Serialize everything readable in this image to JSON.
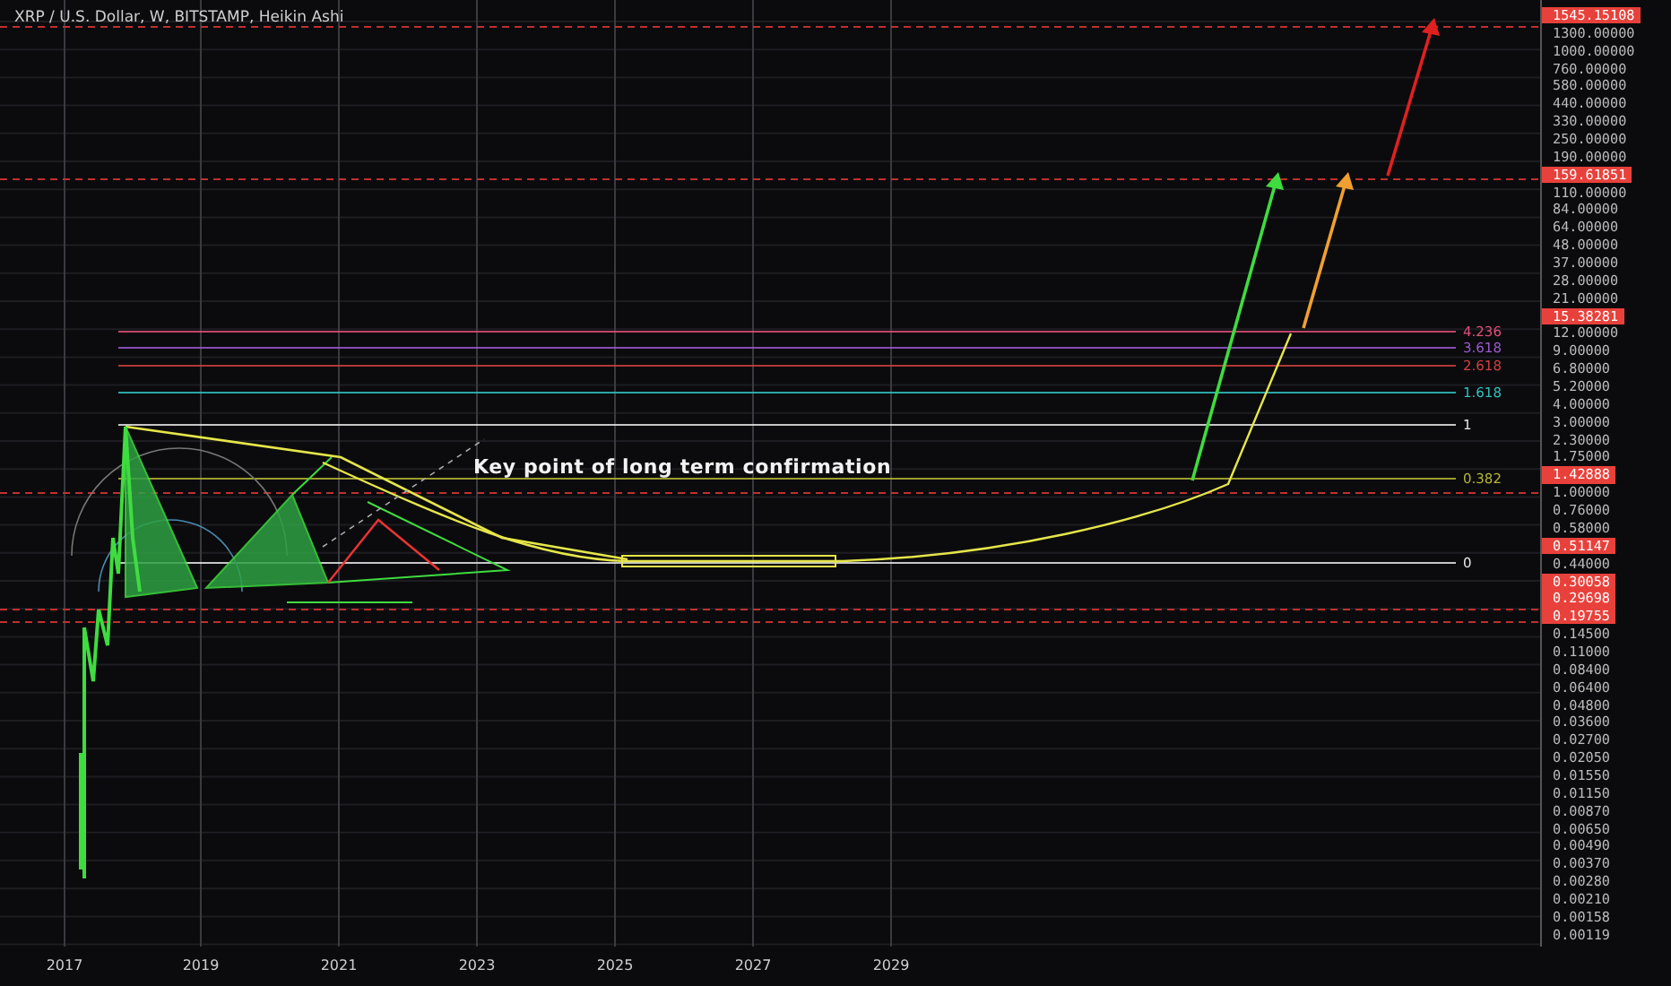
{
  "chart": {
    "title": "XRP / U.S. Dollar, W, BITSTAMP, Heikin Ashi",
    "annotation": "Key point of long term confirmation",
    "fib_levels": [
      {
        "label": "4.236",
        "color": "#e0507a"
      },
      {
        "label": "3.618",
        "color": "#9b59d0"
      },
      {
        "label": "2.618",
        "color": "#d04040"
      },
      {
        "label": "1.618",
        "color": "#30c0c0"
      },
      {
        "label": "1",
        "color": "#e8e8e8"
      },
      {
        "label": "0.382",
        "color": "#b5b536"
      },
      {
        "label": "0",
        "color": "#e8e8e8"
      }
    ]
  },
  "price_axis": [
    {
      "kind": "marker",
      "label": "1545.15108"
    },
    {
      "kind": "tick",
      "label": "1300.00000"
    },
    {
      "kind": "tick",
      "label": "1000.00000"
    },
    {
      "kind": "tick",
      "label": "760.00000"
    },
    {
      "kind": "tick",
      "label": "580.00000"
    },
    {
      "kind": "tick",
      "label": "440.00000"
    },
    {
      "kind": "tick",
      "label": "330.00000"
    },
    {
      "kind": "tick",
      "label": "250.00000"
    },
    {
      "kind": "tick",
      "label": "190.00000"
    },
    {
      "kind": "marker",
      "label": "159.61851"
    },
    {
      "kind": "tick",
      "label": "110.00000"
    },
    {
      "kind": "tick",
      "label": "84.00000"
    },
    {
      "kind": "tick",
      "label": "64.00000"
    },
    {
      "kind": "tick",
      "label": "48.00000"
    },
    {
      "kind": "tick",
      "label": "37.00000"
    },
    {
      "kind": "tick",
      "label": "28.00000"
    },
    {
      "kind": "tick",
      "label": "21.00000"
    },
    {
      "kind": "marker",
      "label": "15.38281"
    },
    {
      "kind": "tick",
      "label": "12.00000"
    },
    {
      "kind": "tick",
      "label": "9.00000"
    },
    {
      "kind": "tick",
      "label": "6.80000"
    },
    {
      "kind": "tick",
      "label": "5.20000"
    },
    {
      "kind": "tick",
      "label": "4.00000"
    },
    {
      "kind": "tick",
      "label": "3.00000"
    },
    {
      "kind": "tick",
      "label": "2.30000"
    },
    {
      "kind": "tick",
      "label": "1.75000"
    },
    {
      "kind": "marker",
      "label": "1.42888"
    },
    {
      "kind": "tick",
      "label": "1.00000"
    },
    {
      "kind": "tick",
      "label": "0.76000"
    },
    {
      "kind": "tick",
      "label": "0.58000"
    },
    {
      "kind": "marker",
      "label": "0.51147"
    },
    {
      "kind": "tick",
      "label": "0.44000"
    },
    {
      "kind": "marker",
      "label": "0.30058"
    },
    {
      "kind": "marker",
      "label": "0.29698"
    },
    {
      "kind": "marker",
      "label": "0.19755"
    },
    {
      "kind": "tick",
      "label": "0.14500"
    },
    {
      "kind": "tick",
      "label": "0.11000"
    },
    {
      "kind": "tick",
      "label": "0.08400"
    },
    {
      "kind": "tick",
      "label": "0.06400"
    },
    {
      "kind": "tick",
      "label": "0.04800"
    },
    {
      "kind": "tick",
      "label": "0.03600"
    },
    {
      "kind": "tick",
      "label": "0.02700"
    },
    {
      "kind": "tick",
      "label": "0.02050"
    },
    {
      "kind": "tick",
      "label": "0.01550"
    },
    {
      "kind": "tick",
      "label": "0.01150"
    },
    {
      "kind": "tick",
      "label": "0.00870"
    },
    {
      "kind": "tick",
      "label": "0.00650"
    },
    {
      "kind": "tick",
      "label": "0.00490"
    },
    {
      "kind": "tick",
      "label": "0.00370"
    },
    {
      "kind": "tick",
      "label": "0.00280"
    },
    {
      "kind": "tick",
      "label": "0.00210"
    },
    {
      "kind": "tick",
      "label": "0.00158"
    },
    {
      "kind": "tick",
      "label": "0.00119"
    }
  ],
  "time_axis": [
    "2017",
    "2019",
    "2021",
    "2023",
    "2025",
    "2027",
    "2029"
  ]
}
